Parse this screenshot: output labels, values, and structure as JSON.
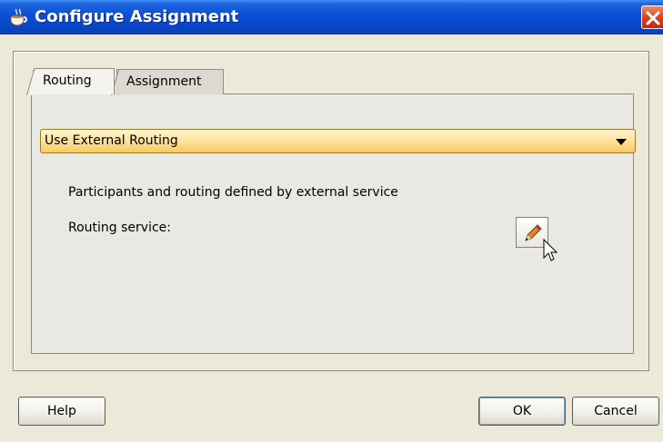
{
  "window": {
    "title": "Configure Assignment",
    "title_icon": "coffee-cup-icon",
    "close_icon": "close-icon"
  },
  "tabs": [
    {
      "label": "Routing",
      "selected": true
    },
    {
      "label": "Assignment",
      "selected": false
    }
  ],
  "routing": {
    "selected_option": "Use External Routing",
    "description": "Participants and routing defined by external service",
    "service_label": "Routing service:",
    "edit_icon": "pencil-icon"
  },
  "buttons": {
    "help": "Help",
    "ok": "OK",
    "cancel": "Cancel"
  }
}
